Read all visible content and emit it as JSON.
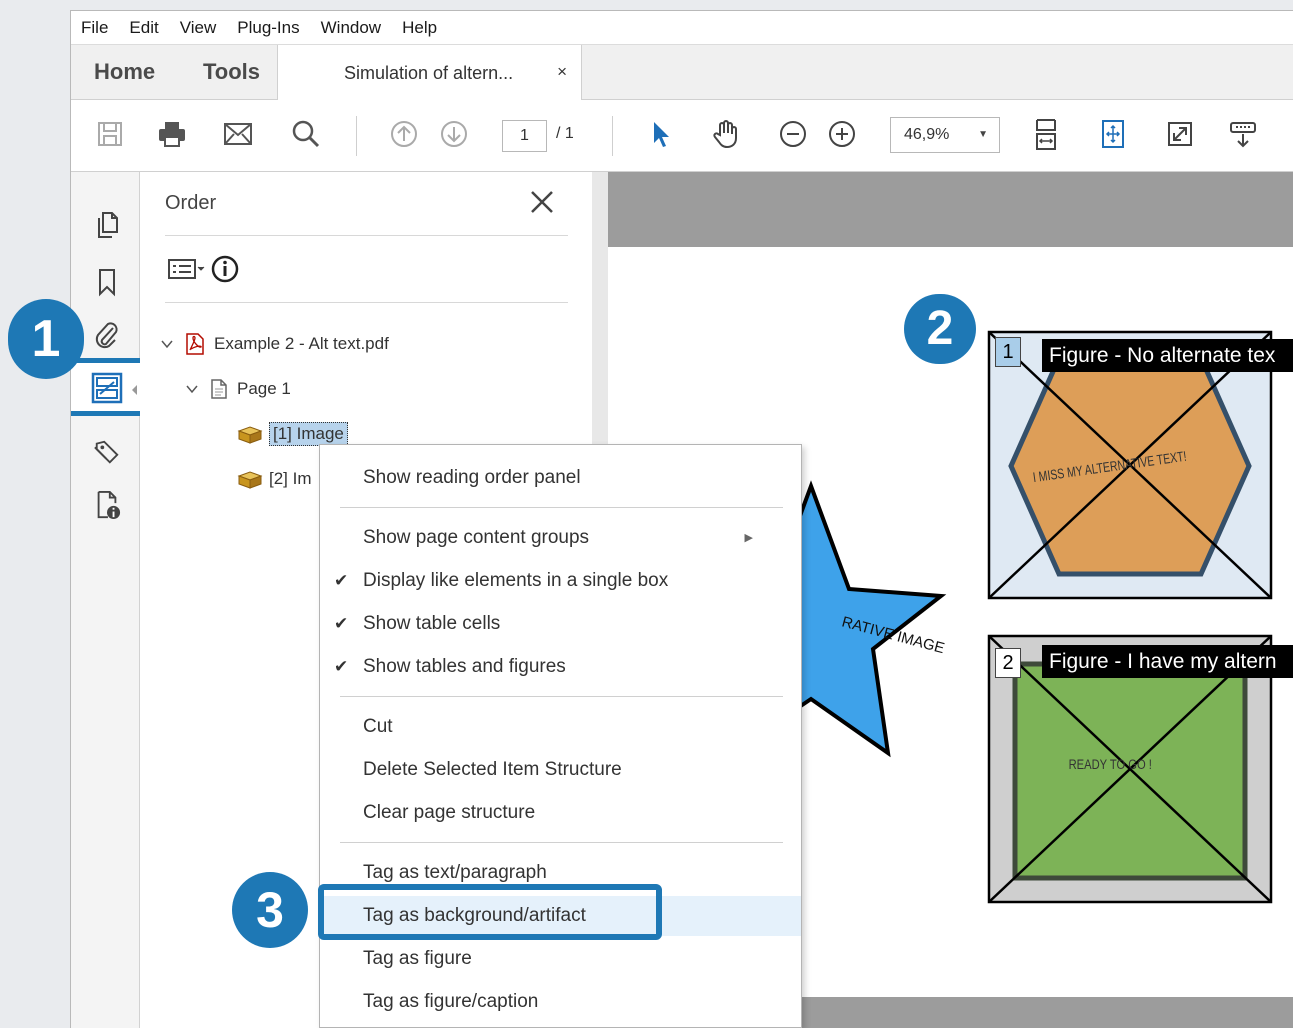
{
  "menubar": {
    "items": [
      "File",
      "Edit",
      "View",
      "Plug-Ins",
      "Window",
      "Help"
    ]
  },
  "tabs": {
    "home": "Home",
    "tools": "Tools",
    "document": "Simulation of altern...",
    "close": "×"
  },
  "toolbar": {
    "page_current": "1",
    "page_total": "/ 1",
    "zoom": "46,9%"
  },
  "panel": {
    "title": "Order",
    "tree": {
      "file": "Example 2 - Alt text.pdf",
      "page": "Page 1",
      "item1": "[1]  Image",
      "item2": "[2]  Im"
    }
  },
  "document": {
    "figure1": {
      "number": "1",
      "label": "Figure - No alternate tex",
      "shape_text": "I MISS MY ALTERNATIVE TEXT!",
      "fill": "#dd9e58",
      "bg": "#dfe9f3"
    },
    "figure2": {
      "number": "2",
      "label": "Figure - I have my altern",
      "shape_text": "READY TO GO !",
      "fill": "#7db357",
      "bg": "#cfcfcf"
    },
    "star_text": "RATIVE IMAGE",
    "star_fill": "#3ea2ea"
  },
  "context_menu": {
    "items": [
      {
        "label": "Show reading order panel"
      },
      {
        "label": "Show page content groups",
        "submenu": true
      },
      {
        "label": "Display like elements in a single box",
        "checked": true
      },
      {
        "label": "Show table cells",
        "checked": true
      },
      {
        "label": "Show tables and figures",
        "checked": true
      },
      {
        "label": "Cut"
      },
      {
        "label": "Delete Selected Item Structure"
      },
      {
        "label": "Clear page structure"
      },
      {
        "label": "Tag as text/paragraph"
      },
      {
        "label": "Tag as background/artifact",
        "highlighted": true
      },
      {
        "label": "Tag as figure"
      },
      {
        "label": "Tag as figure/caption"
      }
    ]
  },
  "callouts": {
    "one": "1",
    "two": "2",
    "three": "3"
  },
  "colors": {
    "accent": "#1e78b5",
    "selection": "#b7d3ec"
  }
}
